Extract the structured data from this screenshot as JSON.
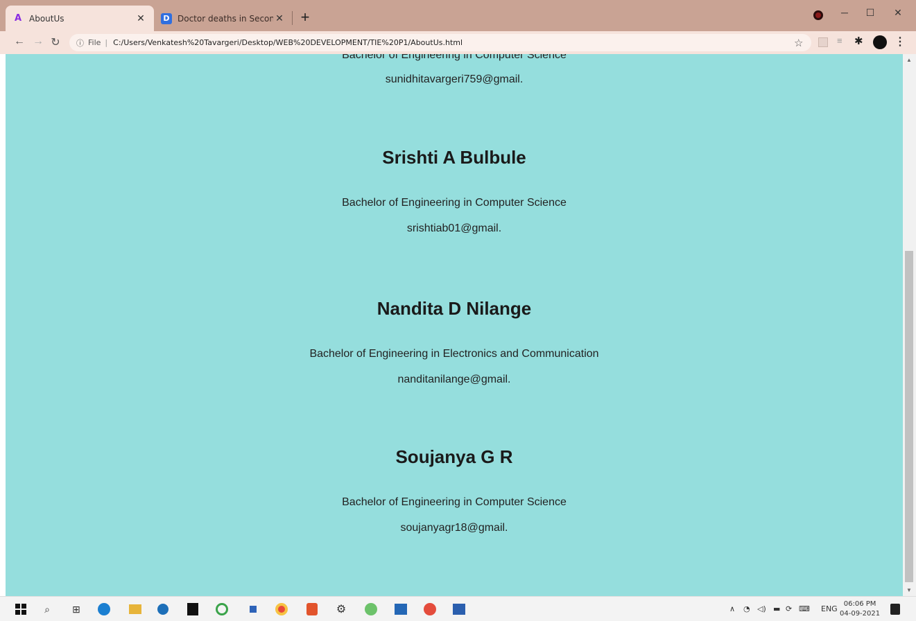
{
  "browser": {
    "tabs": [
      {
        "title": "AboutUs",
        "icon": "letter-a-icon",
        "active": true
      },
      {
        "title": "Doctor deaths in Second Wave",
        "icon": "letter-d-icon",
        "active": false
      }
    ],
    "address": {
      "scheme_label": "File",
      "url": "C:/Users/Venkatesh%20Tavargeri/Desktop/WEB%20DEVELOPMENT/TIE%20P1/AboutUs.html"
    }
  },
  "page": {
    "background": "#95dedd",
    "partial_top": {
      "degree": "Bachelor of Engineering in Computer Science",
      "email": "sunidhitavargeri759@gmail."
    },
    "people": [
      {
        "name": "Srishti A Bulbule",
        "degree": "Bachelor of Engineering in Computer Science",
        "email": "srishtiab01@gmail."
      },
      {
        "name": "Nandita D Nilange",
        "degree": "Bachelor of Engineering in Electronics and Communication",
        "email": "nanditanilange@gmail."
      },
      {
        "name": "Soujanya G R",
        "degree": "Bachelor of Engineering in Computer Science",
        "email": "soujanyagr18@gmail."
      }
    ]
  },
  "taskbar": {
    "lang": "ENG",
    "time": "06:06 PM",
    "date": "04-09-2021"
  }
}
